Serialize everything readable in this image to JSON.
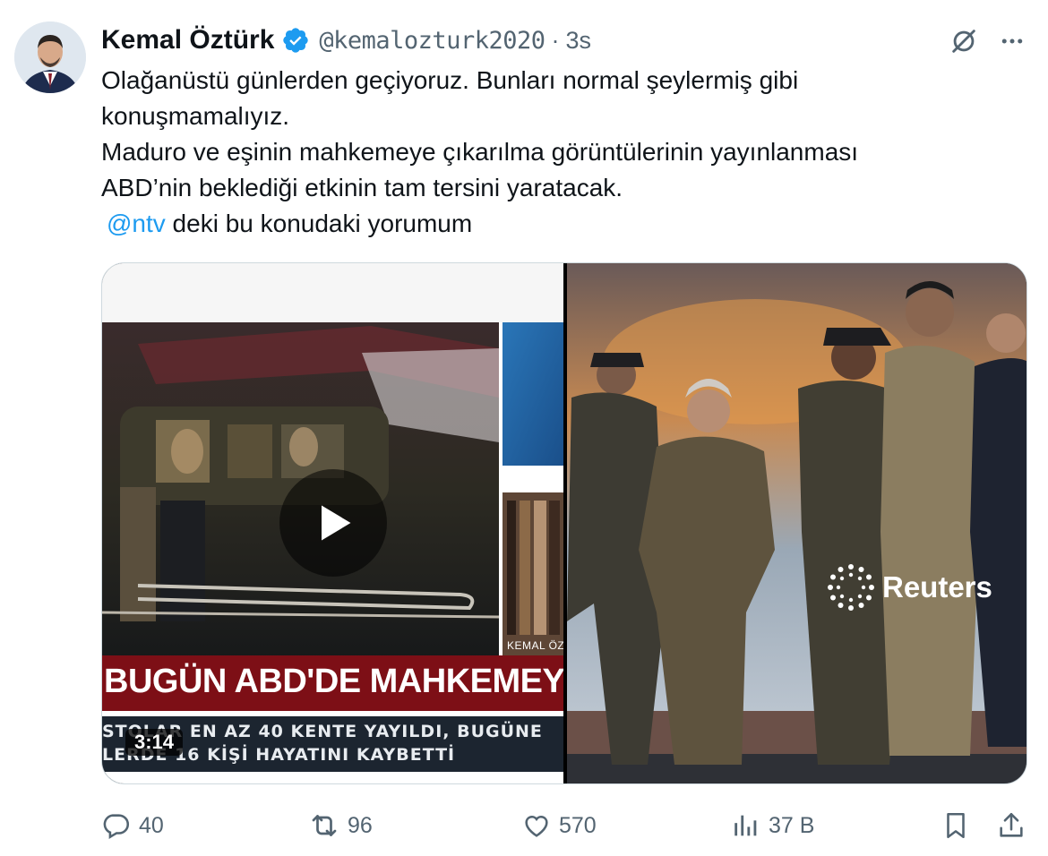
{
  "tweet": {
    "author_name": "Kemal Öztürk",
    "handle": "@kemalozturk2020",
    "separator": "·",
    "time": "3s",
    "text_lines": [
      "Olağanüstü günlerden geçiyoruz. Bunları normal şeylermiş gibi",
      "konuşmamalıyız.",
      "Maduro ve eşinin mahkemeye çıkarılma görüntülerinin yayınlanması",
      "ABD’nin beklediği etkinin tam tersini yaratacak."
    ],
    "mention": "@ntv",
    "mention_suffix": " deki bu konudaki yorumum"
  },
  "media": {
    "video": {
      "duration": "3:14",
      "headline": "BUGÜN ABD'DE MAHKEMEYE Ç",
      "ticker_line1": "STOLAR EN AZ 40 KENTE YAYILDI, BUGÜNE",
      "ticker_line2": "LERDE 16 KİŞİ HAYATINI KAYBETTİ",
      "anchor_label": "KEMAL ÖZ"
    },
    "photo": {
      "watermark": "Reuters"
    }
  },
  "actions": {
    "replies": "40",
    "reposts": "96",
    "likes": "570",
    "views": "37 B"
  },
  "colors": {
    "accent": "#1d9bf0",
    "secondary_text": "#536471",
    "verified": "#1d9bf0",
    "headline_bar": "#7d0f16"
  },
  "icons": [
    "verified-badge-icon",
    "grok-icon",
    "more-icon",
    "play-icon",
    "reply-icon",
    "repost-icon",
    "like-icon",
    "views-icon",
    "bookmark-icon",
    "share-icon"
  ]
}
